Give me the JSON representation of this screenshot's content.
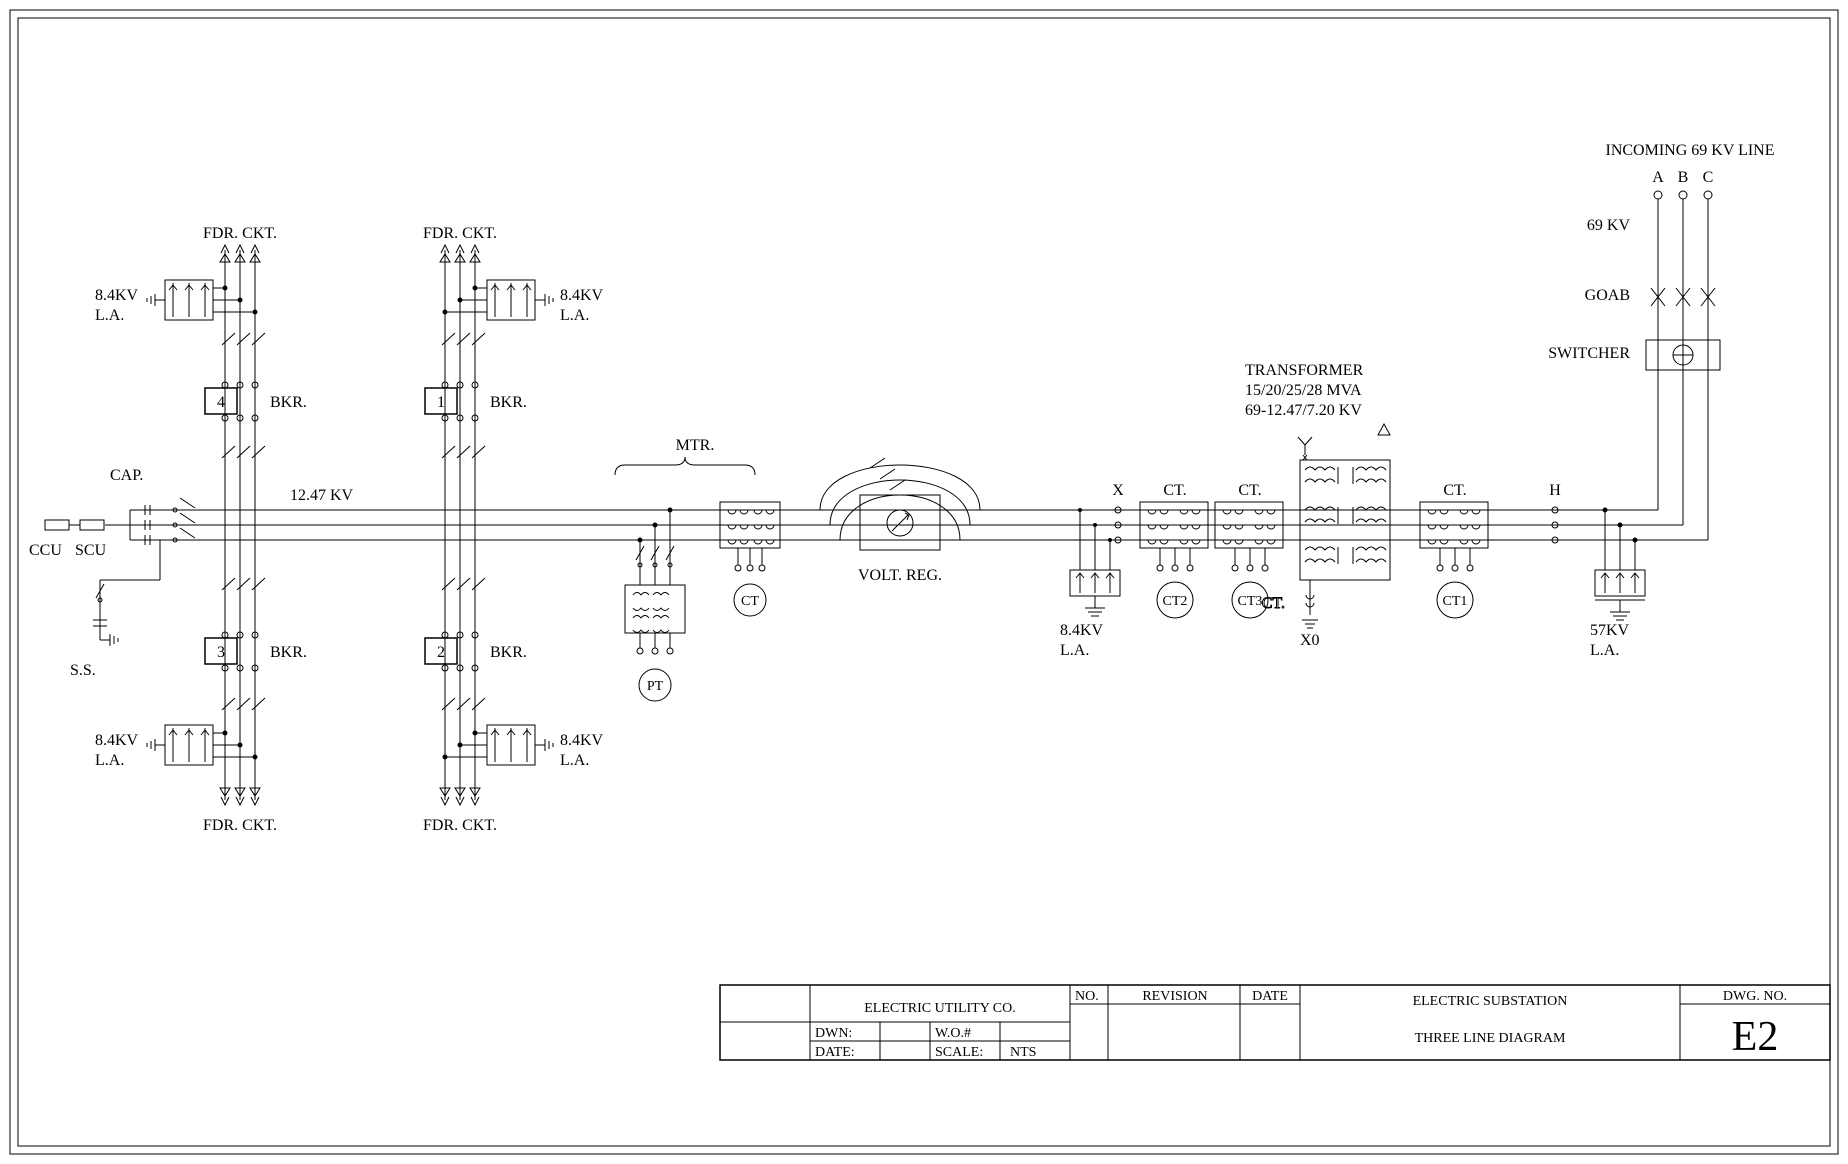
{
  "incoming": {
    "title": "INCOMING 69 KV LINE",
    "phases": {
      "a": "A",
      "b": "B",
      "c": "C"
    },
    "kv": "69 KV",
    "goab": "GOAB",
    "switcher": "SWITCHER"
  },
  "transformer": {
    "title": "TRANSFORMER",
    "mva": "15/20/25/28 MVA",
    "kv": "69-12.47/7.20 KV"
  },
  "ct": {
    "label": "CT.",
    "ct1": "CT1",
    "ct2": "CT2",
    "ct3": "CT3",
    "ct": "CT"
  },
  "pt": "PT",
  "mtr": "MTR.",
  "voltreg": "VOLT. REG.",
  "x": "X",
  "h": "H",
  "x0": "X0",
  "bus": {
    "kv": "12.47 KV"
  },
  "la": {
    "hv": "57KV",
    "hv2": "L.A.",
    "lv": "8.4KV",
    "lv2": "L.A."
  },
  "feeder": {
    "fdrckt": "FDR. CKT.",
    "bkr": "BKR.",
    "b1": "1",
    "b2": "2",
    "b3": "3",
    "b4": "4"
  },
  "cap": "CAP.",
  "ccu": "CCU",
  "scu": "SCU",
  "ss": "S.S.",
  "titleblock": {
    "company": "ELECTRIC UTILITY CO.",
    "dwn": "DWN:",
    "date": "DATE:",
    "wo": "W.O.#",
    "scale_l": "SCALE:",
    "scale": "NTS",
    "no": "NO.",
    "rev": "REVISION",
    "datecol": "DATE",
    "proj": "ELECTRIC SUBSTATION",
    "title": "THREE LINE DIAGRAM",
    "dwgno_l": "DWG. NO.",
    "dwgno": "E2"
  }
}
